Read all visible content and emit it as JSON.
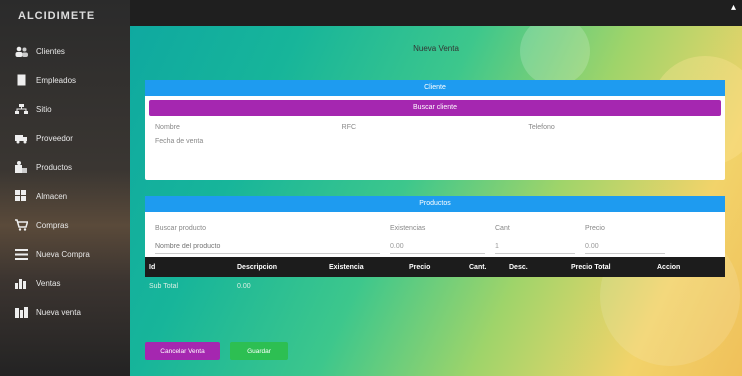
{
  "app": {
    "brand": "ALCIDIMETE"
  },
  "sidebar": {
    "items": [
      {
        "label": "Clientes",
        "icon": "users-icon"
      },
      {
        "label": "Empleados",
        "icon": "id-card-icon"
      },
      {
        "label": "Sitio",
        "icon": "sitemap-icon"
      },
      {
        "label": "Proveedor",
        "icon": "truck-icon"
      },
      {
        "label": "Productos",
        "icon": "box-icon"
      },
      {
        "label": "Almacen",
        "icon": "warehouse-icon"
      },
      {
        "label": "Compras",
        "icon": "cart-icon"
      },
      {
        "label": "Nueva Compra",
        "icon": "list-icon"
      },
      {
        "label": "Ventas",
        "icon": "chart-icon"
      },
      {
        "label": "Nueva venta",
        "icon": "cash-icon"
      }
    ]
  },
  "topbar": {
    "user_glyph": "▴"
  },
  "page": {
    "title": "Nueva Venta"
  },
  "client_card": {
    "header": "Cliente",
    "subheader": "Buscar cliente",
    "labels": [
      "Nombre",
      "RFC",
      "Telefono"
    ],
    "date": "Fecha de venta"
  },
  "product_card": {
    "header": "Productos",
    "row1": {
      "name_label": "Buscar producto",
      "stock_label": "Existencias",
      "qty_label": "Cant",
      "price_label": "Precio"
    },
    "row2": {
      "name_placeholder": "Nombre del producto",
      "stock_value": "0.00",
      "qty_value": "1",
      "price_value": "0.00"
    }
  },
  "table": {
    "headers": [
      "Id",
      "Descripcion",
      "Existencia",
      "Precio",
      "Cant.",
      "Desc.",
      "Precio Total",
      "Accion"
    ],
    "row": {
      "label": "Sub Total",
      "value": "0.00"
    }
  },
  "buttons": {
    "cancel": "Cancelar Venta",
    "save": "Guardar"
  },
  "colors": {
    "blue": "#1e9bf0",
    "purple": "#a527b0",
    "green": "#2dbf52",
    "dark": "#1c1c1c"
  }
}
